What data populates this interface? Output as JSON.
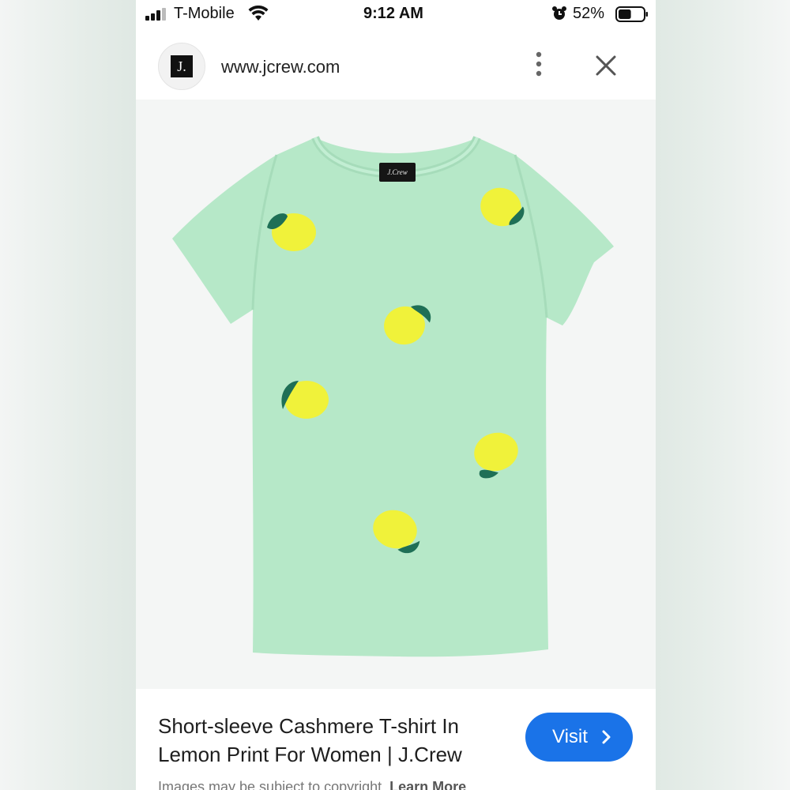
{
  "status_bar": {
    "carrier": "T-Mobile",
    "time": "9:12 AM",
    "battery_percent": "52%",
    "battery_level": 0.52
  },
  "url_bar": {
    "site_logo_text": "J.",
    "url": "www.jcrew.com"
  },
  "product_image": {
    "brand_label": "J.Crew",
    "shirt_color": "#b6e8c8",
    "lemon_color": "#f0f23a",
    "leaf_color": "#1f6f56"
  },
  "caption": {
    "title_line1": "Short-sleeve Cashmere T-shirt In",
    "title_line2": "Lemon Print For Women | J.Crew",
    "visit_label": "Visit",
    "disclaimer": "Images may be subject to copyright.",
    "learn_more": "Learn More"
  },
  "colors": {
    "accent": "#1a73e8"
  }
}
